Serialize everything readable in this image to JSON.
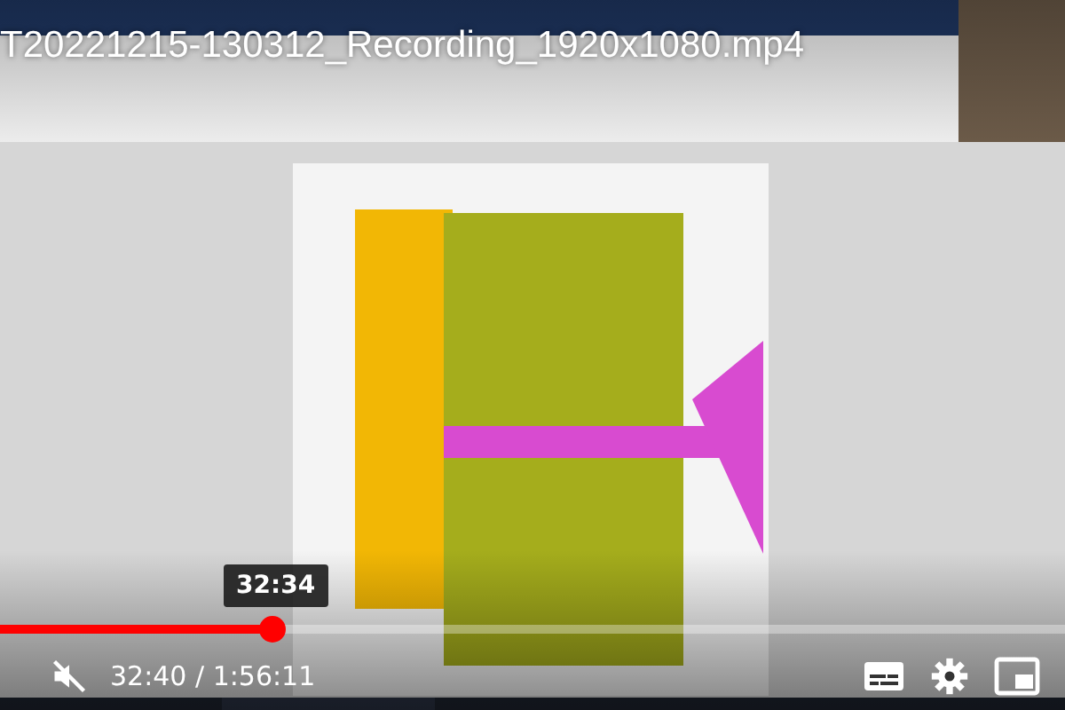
{
  "title": "T20221215-130312_Recording_1920x1080.mp4",
  "player": {
    "muted": true,
    "level": 0.255,
    "hover_time": "32:34",
    "time": "32:40 / 1:56:11"
  }
}
